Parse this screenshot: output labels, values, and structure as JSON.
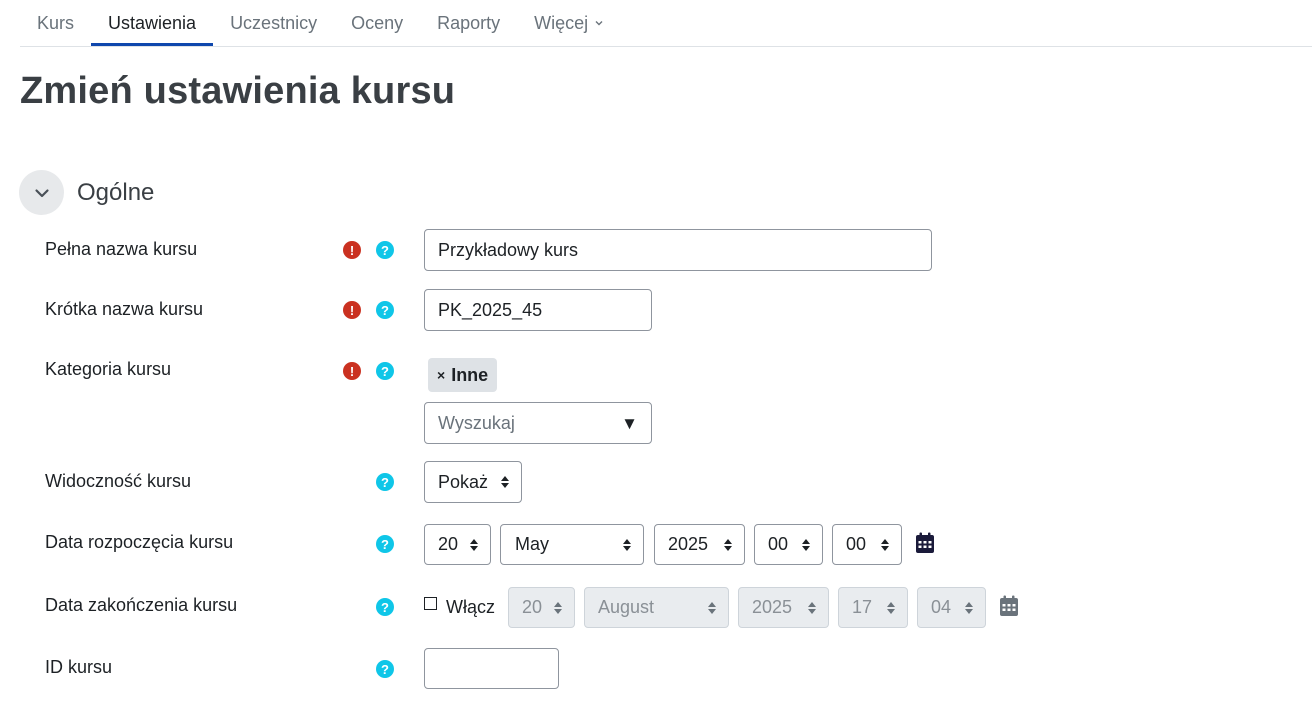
{
  "nav": {
    "items": [
      {
        "label": "Kurs"
      },
      {
        "label": "Ustawienia"
      },
      {
        "label": "Uczestnicy"
      },
      {
        "label": "Oceny"
      },
      {
        "label": "Raporty"
      },
      {
        "label": "Więcej"
      }
    ],
    "active_index": 1
  },
  "page_title": "Zmień ustawienia kursu",
  "section": {
    "title": "Ogólne",
    "collapse_icon": "chevron-down-icon"
  },
  "form": {
    "fullname": {
      "label": "Pełna nazwa kursu",
      "value": "Przykładowy kurs",
      "required": true
    },
    "shortname": {
      "label": "Krótka nazwa kursu",
      "value": "PK_2025_45",
      "required": true
    },
    "category": {
      "label": "Kategoria kursu",
      "required": true,
      "selected_tag": "Inne",
      "tag_remove": "×",
      "search_placeholder": "Wyszukaj",
      "dropdown_arrow": "▼"
    },
    "visibility": {
      "label": "Widoczność kursu",
      "value": "Pokaż"
    },
    "startdate": {
      "label": "Data rozpoczęcia kursu",
      "day": "20",
      "month": "May",
      "year": "2025",
      "hour": "00",
      "minute": "00"
    },
    "enddate": {
      "label": "Data zakończenia kursu",
      "enable_label": "Włącz",
      "enabled": false,
      "day": "20",
      "month": "August",
      "year": "2025",
      "hour": "17",
      "minute": "04"
    },
    "idnumber": {
      "label": "ID kursu",
      "value": ""
    }
  },
  "icons": {
    "required": "exclamation-circle-icon",
    "help": "question-circle-icon",
    "calendar": "calendar-icon"
  },
  "colors": {
    "required": "#ca3120",
    "help": "#0fc6e8",
    "active_tab_underline": "#0f47ad",
    "calendar_active": "#1a1a3a",
    "calendar_disabled": "#6a737b"
  }
}
